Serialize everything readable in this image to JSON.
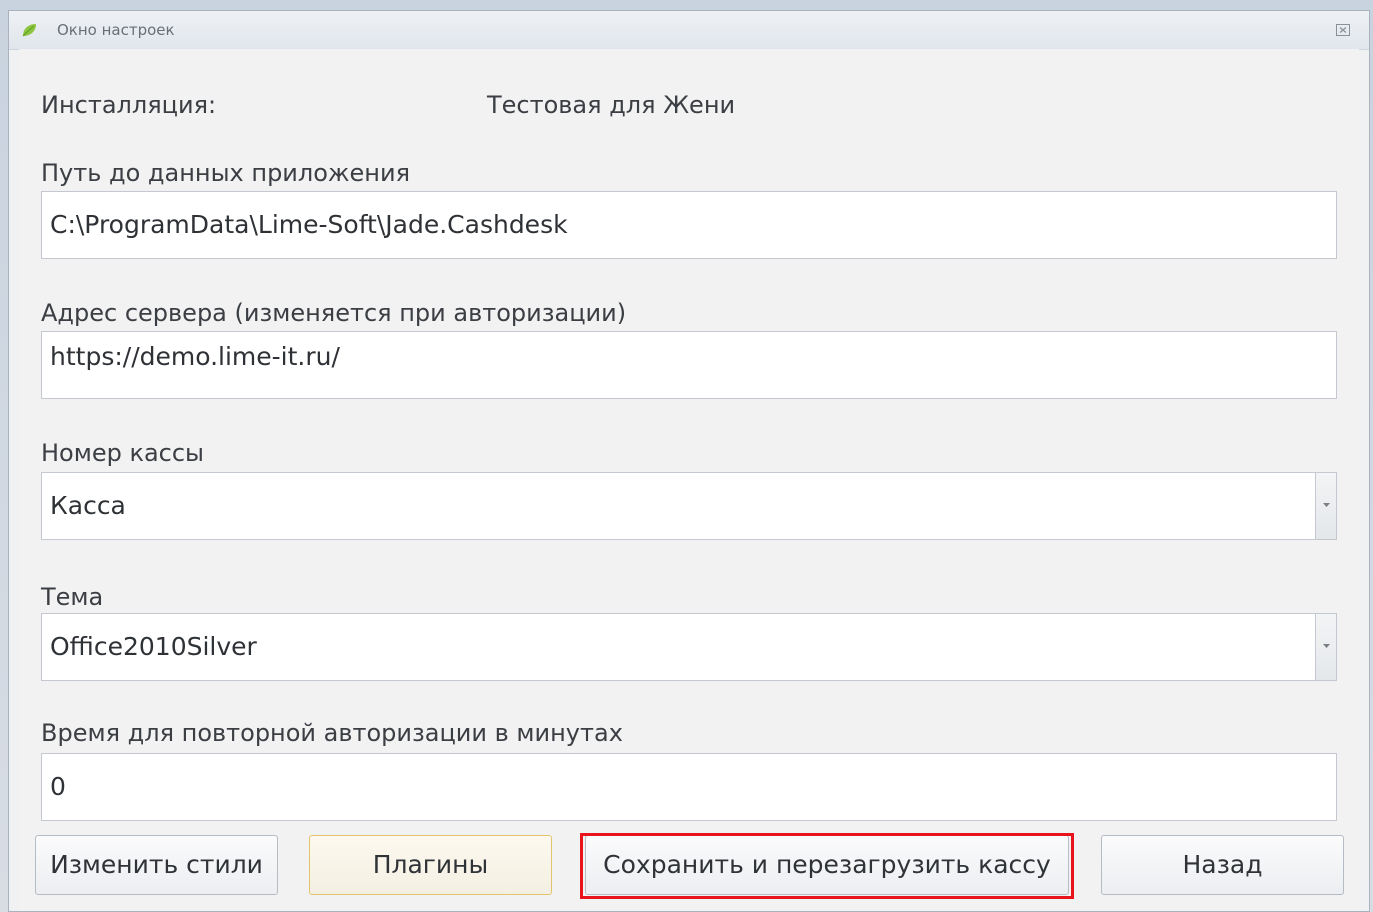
{
  "window": {
    "title": "Окно настроек"
  },
  "installation": {
    "label": "Инсталляция:",
    "value": "Тестовая для Жени"
  },
  "app_data_path": {
    "label": "Путь до данных приложения",
    "value": "C:\\ProgramData\\Lime-Soft\\Jade.Cashdesk"
  },
  "server_address": {
    "label": "Адрес сервера (изменяется при авторизации)",
    "value": "https://demo.lime-it.ru/"
  },
  "cashdesk_number": {
    "label": "Номер кассы",
    "value": "Касса"
  },
  "theme": {
    "label": "Тема",
    "value": "Office2010Silver"
  },
  "reauth_time": {
    "label": "Время для повторной авторизации в минутах",
    "value": "0"
  },
  "buttons": {
    "change_styles": "Изменить стили",
    "plugins": "Плагины",
    "save_restart": "Сохранить и перезагрузить кассу",
    "back": "Назад"
  },
  "colors": {
    "highlight": "#e8131b",
    "focus_border": "#e3c36b"
  }
}
